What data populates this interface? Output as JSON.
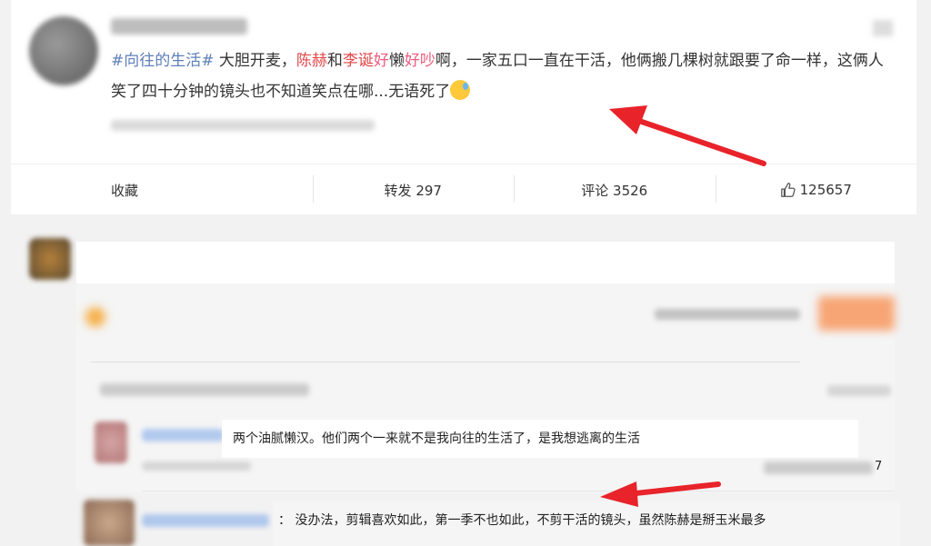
{
  "post": {
    "text_parts": [
      {
        "text": "#向往的生活#",
        "style": "tag"
      },
      {
        "text": " 大胆开麦，",
        "style": "plain"
      },
      {
        "text": "陈赫",
        "style": "red"
      },
      {
        "text": "和",
        "style": "plain"
      },
      {
        "text": "李诞",
        "style": "red"
      },
      {
        "text": "好",
        "style": "pink"
      },
      {
        "text": "懒",
        "style": "plain"
      },
      {
        "text": "好吵",
        "style": "pink"
      },
      {
        "text": "啊，一家五口一直在干活，他俩搬几棵树就跟要了命一样，这俩人笑了四十分钟的镜头也不知道笑点在哪...无语死了",
        "style": "plain"
      }
    ],
    "emoji_icon": "sweat-smile-emoji"
  },
  "actions": {
    "collect_label": "收藏",
    "repost_label": "转发 297",
    "comment_label": "评论 3526",
    "like_count": "125657",
    "like_icon": "thumbs-up-icon"
  },
  "comments": [
    {
      "text": "两个油腻懒汉。他们两个一来就不是我向往的生活了，是我想逃离的生活"
    },
    {
      "text": "：  没办法，剪辑喜欢如此，第一季不也如此，不剪干活的镜头，虽然陈赫是掰玉米最多"
    }
  ],
  "misc": {
    "partial_count_digit": "7"
  },
  "colors": {
    "topic_blue": "#5d7fb8",
    "name_red": "#e1474a",
    "arrow_red": "#e8232a"
  }
}
